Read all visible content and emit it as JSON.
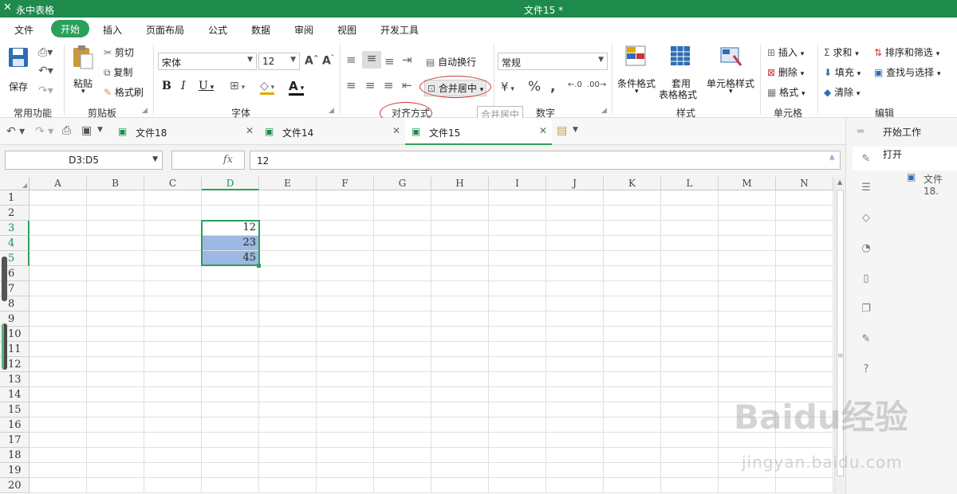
{
  "app": {
    "name": "永中表格",
    "document_title": "文件15 *"
  },
  "menu": [
    "文件",
    "开始",
    "插入",
    "页面布局",
    "公式",
    "数据",
    "审阅",
    "视图",
    "开发工具"
  ],
  "menu_active": "开始",
  "ribbon": {
    "clipboard": {
      "save": "保存",
      "paste": "粘贴",
      "cut": "剪切",
      "copy": "复制",
      "format_painter": "格式刷",
      "group_common": "常用功能",
      "group": "剪贴板"
    },
    "font": {
      "name": "宋体",
      "size": "12",
      "group": "字体"
    },
    "alignment": {
      "wrap_text": "自动换行",
      "merge_center": "合并居中",
      "group": "对齐方式"
    },
    "number": {
      "format": "常规",
      "group": "数字"
    },
    "styles": {
      "conditional": "条件格式",
      "apply_table_line1": "套用",
      "apply_table_line2": "表格格式",
      "cell_style": "单元格样式",
      "group": "样式"
    },
    "cells": {
      "insert": "插入",
      "delete": "删除",
      "format": "格式",
      "group": "单元格"
    },
    "editing": {
      "sum": "求和",
      "sort_filter": "排序和筛选",
      "fill": "填充",
      "find_select": "查找与选择",
      "clear": "清除",
      "group": "编辑"
    }
  },
  "tooltip": "合并居中",
  "tabs": [
    {
      "label": "文件18"
    },
    {
      "label": "文件14"
    },
    {
      "label": "文件15"
    }
  ],
  "active_tab": "文件15",
  "formula_bar": {
    "name_box": "D3:D5",
    "fx": "fx",
    "value": "12"
  },
  "columns": [
    "A",
    "B",
    "C",
    "D",
    "E",
    "F",
    "G",
    "H",
    "I",
    "J",
    "K",
    "L",
    "M",
    "N"
  ],
  "rows": [
    "1",
    "2",
    "3",
    "4",
    "5",
    "6",
    "7",
    "8",
    "9",
    "10",
    "11",
    "12",
    "13",
    "14",
    "15",
    "16",
    "17",
    "18",
    "19",
    "20"
  ],
  "cells": {
    "D3": "12",
    "D4": "23",
    "D5": "45"
  },
  "selection": "D3:D5",
  "right_panel": {
    "title": "开始工作",
    "open": "打开",
    "recent_file": "文件18."
  },
  "watermark": {
    "line1": "Baidu经验",
    "line2": "jingyan.baidu.com"
  },
  "colors": {
    "accent": "#1e8a4c",
    "selection_fill": "#9db8e2",
    "callout": "#cc3333"
  }
}
